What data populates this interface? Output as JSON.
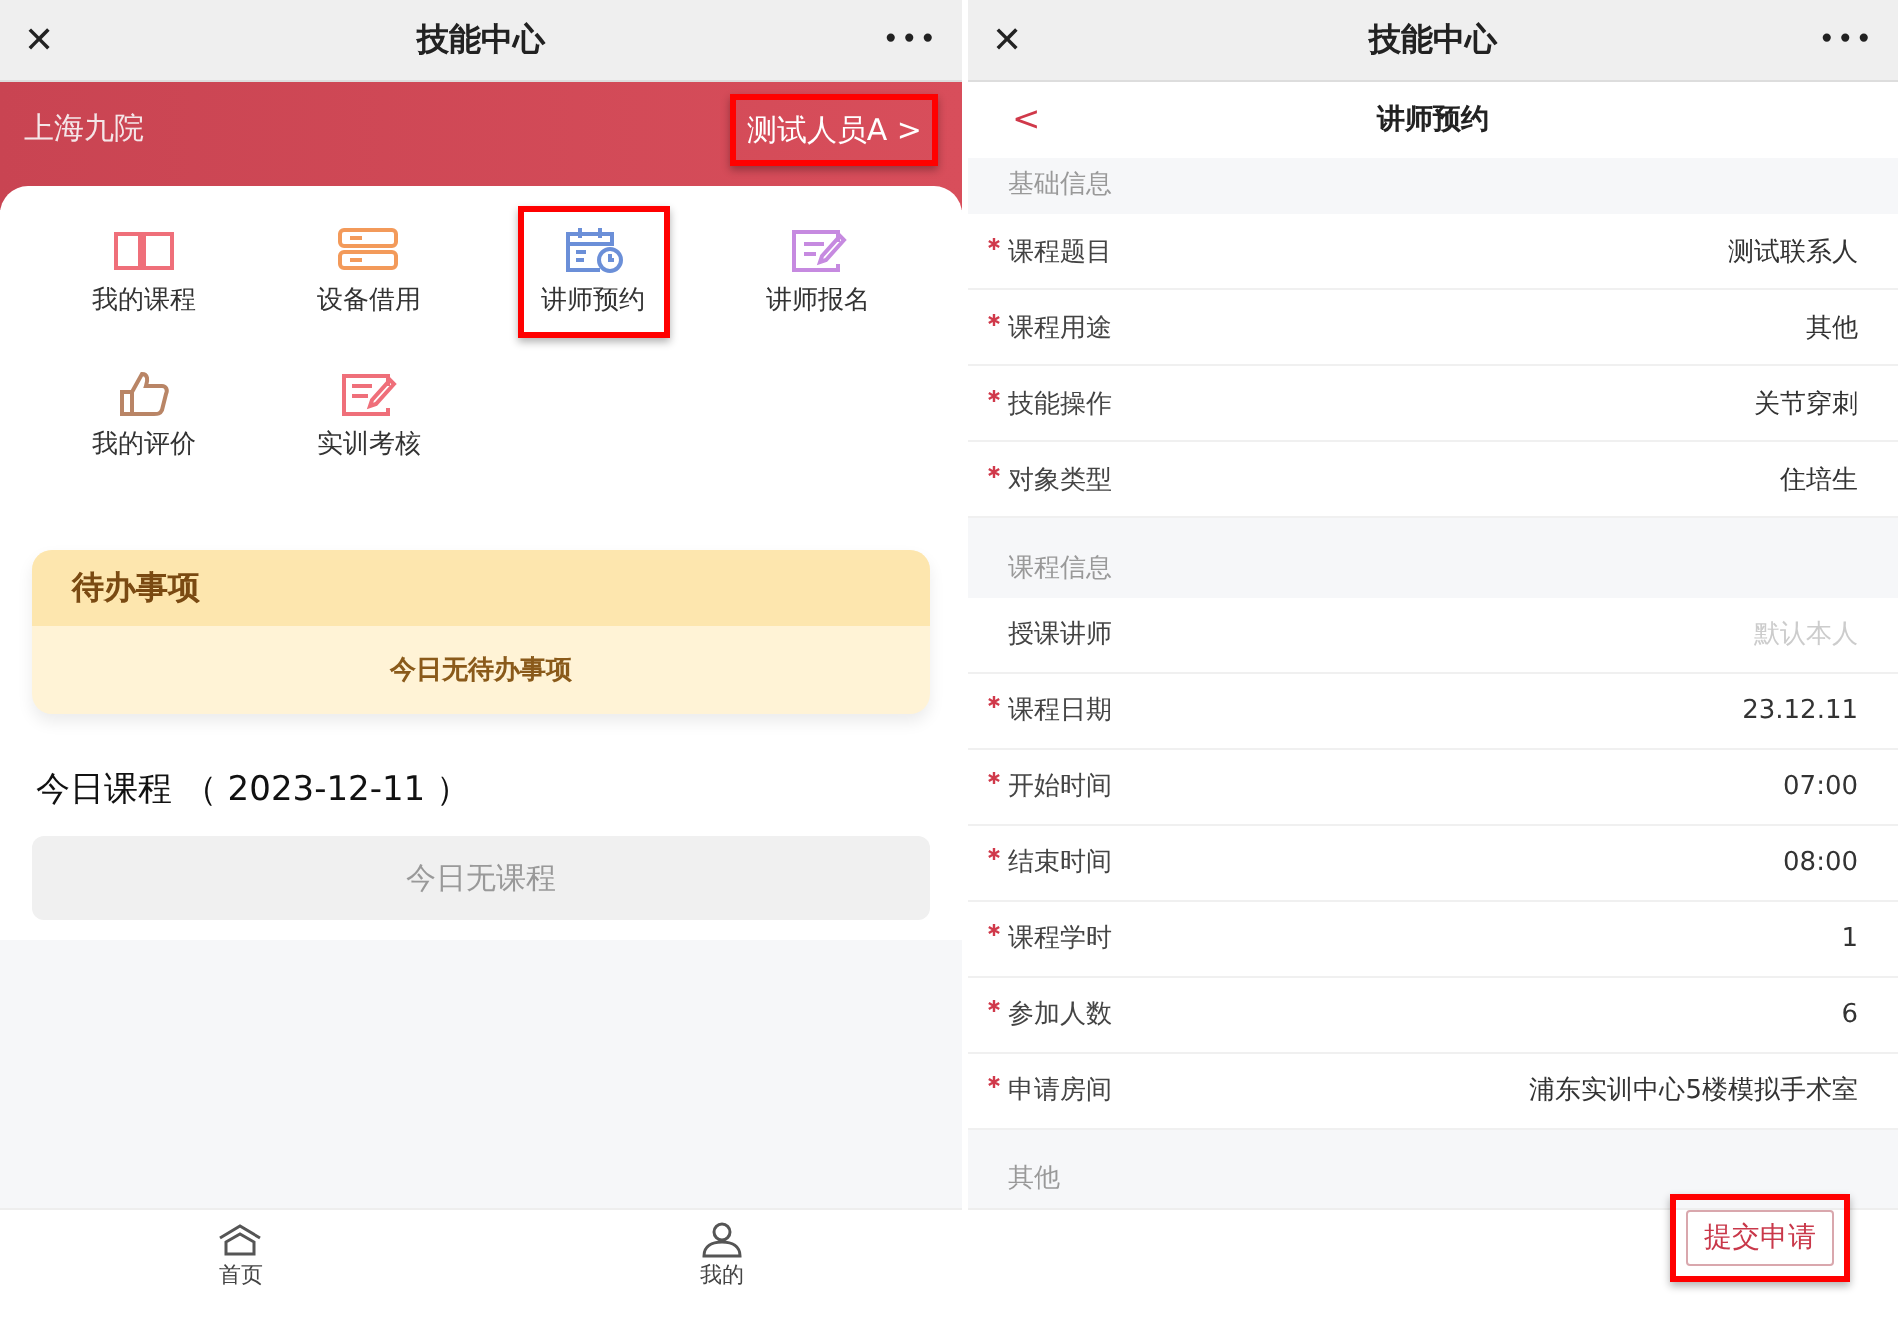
{
  "home_screen": {
    "title_bar": {
      "close": "✕",
      "title": "技能中心",
      "more": "•••"
    },
    "header": {
      "org": "上海九院",
      "user": {
        "label": "测试人员A",
        "chevron": ">",
        "highlighted": true
      }
    },
    "menu": [
      {
        "kind": "book",
        "label": "我的课程",
        "highlighted": false
      },
      {
        "kind": "server",
        "label": "设备借用",
        "highlighted": false
      },
      {
        "kind": "calendar",
        "label": "讲师预约",
        "highlighted": true
      },
      {
        "kind": "note",
        "label": "讲师报名",
        "highlighted": false
      },
      {
        "kind": "thumb",
        "label": "我的评价",
        "highlighted": false
      },
      {
        "kind": "exam",
        "label": "实训考核",
        "highlighted": false
      }
    ],
    "todo": {
      "title": "待办事项",
      "empty": "今日无待办事项"
    },
    "courses": {
      "title": "今日课程 （ 2023-12-11 ）",
      "empty": "今日无课程"
    },
    "tabbar": [
      {
        "kind": "home",
        "label": "首页"
      },
      {
        "kind": "user",
        "label": "我的"
      }
    ]
  },
  "booking_screen": {
    "title_bar": {
      "close": "✕",
      "title": "技能中心",
      "more": "•••"
    },
    "nav": {
      "back": "<",
      "title": "讲师预约"
    },
    "sections": [
      {
        "title": "基础信息",
        "rows": [
          {
            "label": "课程题目",
            "required": true,
            "value": "测试联系人"
          },
          {
            "label": "课程用途",
            "required": true,
            "value": "其他"
          },
          {
            "label": "技能操作",
            "required": true,
            "value": "关节穿刺"
          },
          {
            "label": "对象类型",
            "required": true,
            "value": "住培生"
          }
        ]
      },
      {
        "title": "课程信息",
        "rows": [
          {
            "label": "授课讲师",
            "required": false,
            "placeholder": "默认本人"
          },
          {
            "label": "课程日期",
            "required": true,
            "value": "23.12.11"
          },
          {
            "label": "开始时间",
            "required": true,
            "value": "07:00"
          },
          {
            "label": "结束时间",
            "required": true,
            "value": "08:00"
          },
          {
            "label": "课程学时",
            "required": true,
            "value": "1"
          },
          {
            "label": "参加人数",
            "required": true,
            "value": "6"
          },
          {
            "label": "申请房间",
            "required": true,
            "value": "浦东实训中心5楼模拟手术室"
          }
        ]
      },
      {
        "title": "其他"
      }
    ],
    "submit": {
      "label": "提交申请",
      "highlighted": true
    }
  }
}
